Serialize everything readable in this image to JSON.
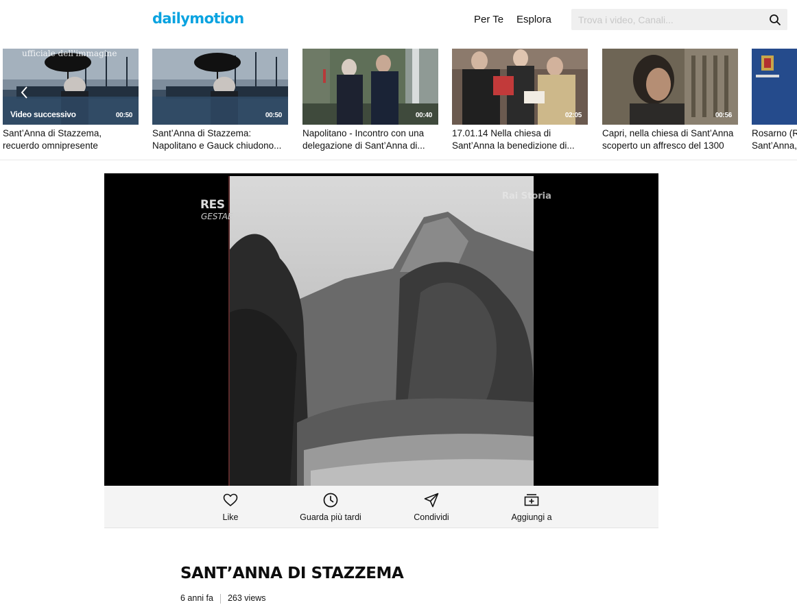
{
  "header": {
    "logo": "dailymotion",
    "nav": [
      "Per Te",
      "Esplora"
    ],
    "search_placeholder": "Trova i video, Canali..."
  },
  "carousel": {
    "overlay_text": "ufficiale dell'immagine",
    "next_label": "Video successivo",
    "items": [
      {
        "line1": "Sant’Anna di Stazzema,",
        "line2": "recuerdo omnipresente",
        "duration": "00:50"
      },
      {
        "line1": "Sant’Anna di Stazzema:",
        "line2": "Napolitano e Gauck chiudono...",
        "duration": "00:50"
      },
      {
        "line1": "Napolitano - Incontro con una",
        "line2": "delegazione di Sant’Anna di...",
        "duration": "00:40"
      },
      {
        "line1": "17.01.14 Nella chiesa di",
        "line2": "Sant’Anna la benedizione di...",
        "duration": "02:05"
      },
      {
        "line1": "Capri, nella chiesa di Sant’Anna",
        "line2": "scoperto un affresco del 1300",
        "duration": "00:56"
      },
      {
        "line1": "Rosarno (R",
        "line2": "Sant’Anna,",
        "duration": ""
      }
    ]
  },
  "player": {
    "watermark_left_1": "RES",
    "watermark_left_2": "GESTAE",
    "watermark_right": "Rai Storia"
  },
  "actions": {
    "like": "Like",
    "watch_later": "Guarda più tardi",
    "share": "Condividi",
    "add": "Aggiungi a"
  },
  "video": {
    "title": "SANT’ANNA DI STAZZEMA",
    "age": "6 anni fa",
    "views": "263 views"
  },
  "colors": {
    "brand": "#0aa3e0",
    "thumb_blue": "#2f4a66"
  }
}
